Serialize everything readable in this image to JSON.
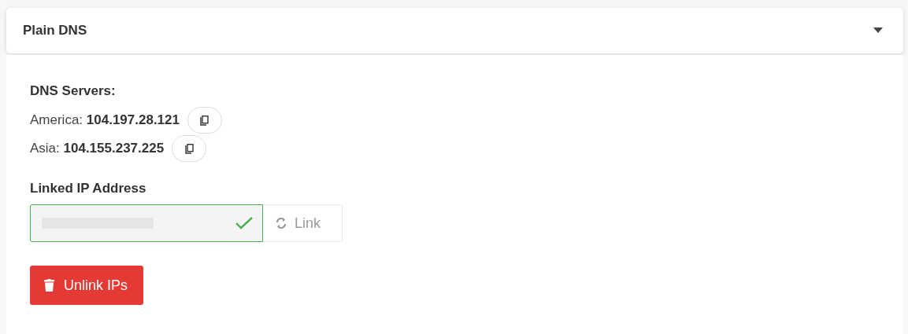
{
  "panel": {
    "title": "Plain DNS",
    "expanded": true
  },
  "dns_servers": {
    "heading": "DNS Servers:",
    "servers": [
      {
        "region": "America:",
        "address": "104.197.28.121"
      },
      {
        "region": "Asia:",
        "address": "104.155.237.225"
      }
    ]
  },
  "linked_ip": {
    "label": "Linked IP Address",
    "valid": true,
    "link_button": {
      "label": "Link",
      "disabled": true
    }
  },
  "unlink_button": {
    "label": "Unlink IPs"
  }
}
